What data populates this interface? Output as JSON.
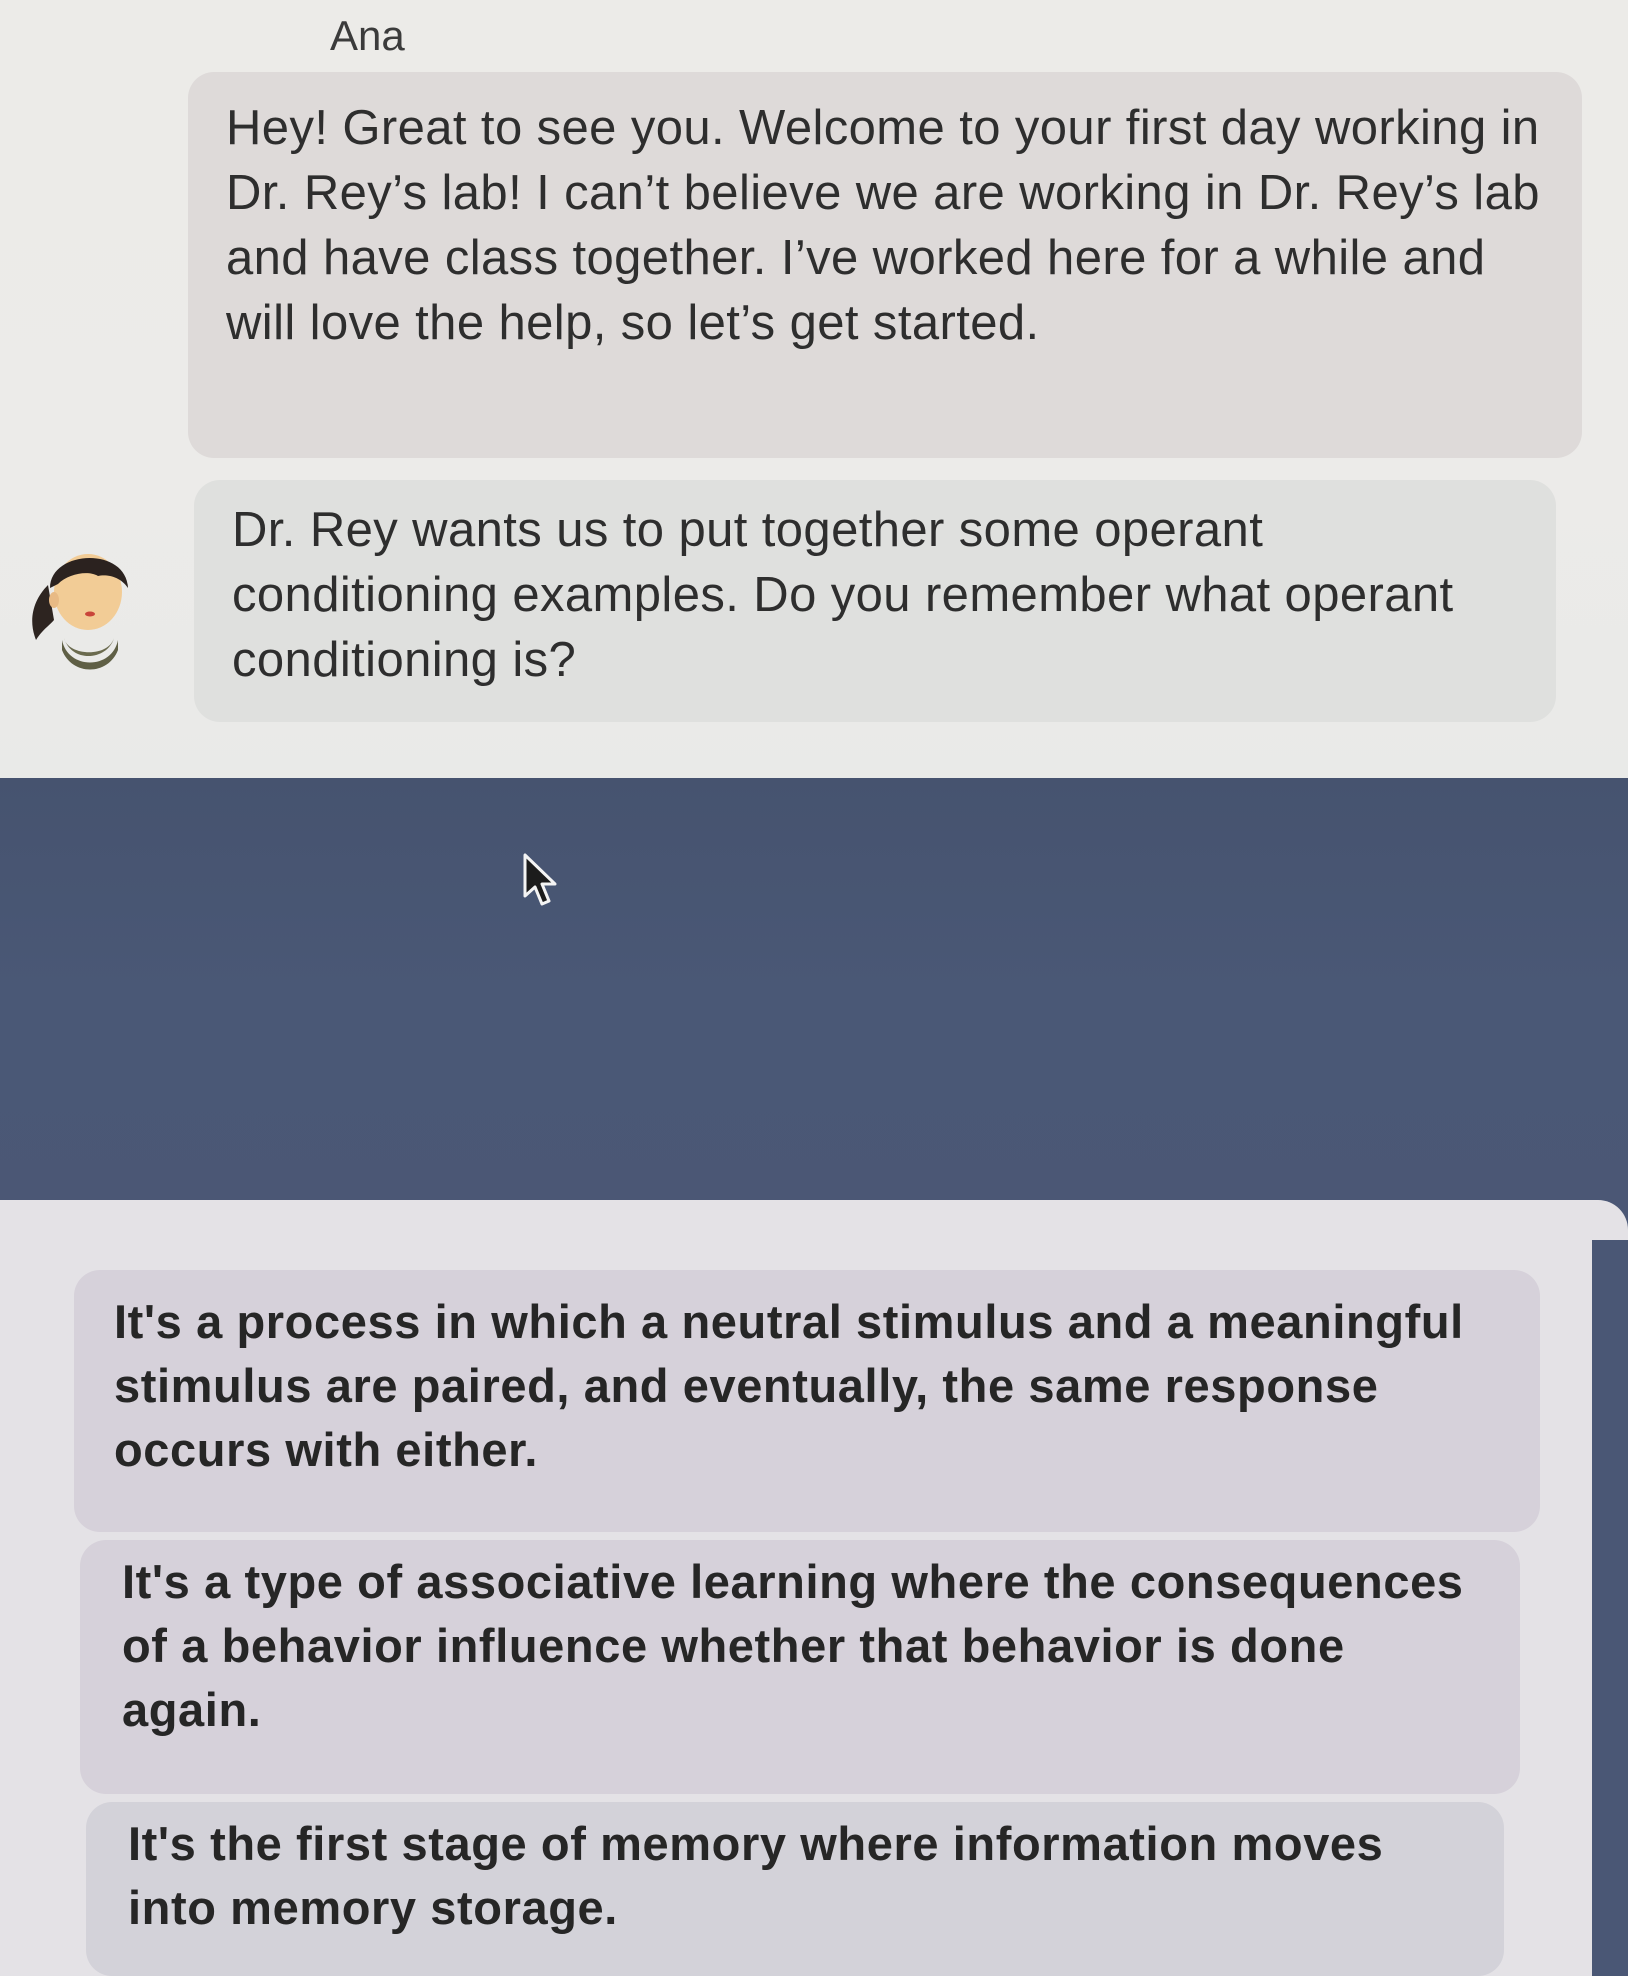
{
  "chat": {
    "sender_name": "Ana",
    "messages": [
      "Hey! Great to see you. Welcome to your first day working in Dr. Rey’s lab! I can’t believe we are working in Dr. Rey’s lab and have class together. I’ve worked here for a while and will love the help, so let’s get started.",
      "Dr. Rey wants us to put together some operant conditioning examples. Do you remember what operant conditioning is?"
    ]
  },
  "avatar": {
    "icon": "character-avatar-icon"
  },
  "cursor": {
    "icon": "mouse-pointer-icon"
  },
  "options": [
    "It's a process in which a neutral stimulus and a meaningful stimulus are paired, and eventually, the same response occurs with either.",
    "It's a type of associative learning where the consequences of a behavior influence whether that behavior is done again.",
    "It's the first stage of memory where information moves into memory storage."
  ],
  "colors": {
    "dark_band": "#4a5876",
    "chat_bubble": "#dedad9",
    "option_bubble": "#d6d1da"
  }
}
